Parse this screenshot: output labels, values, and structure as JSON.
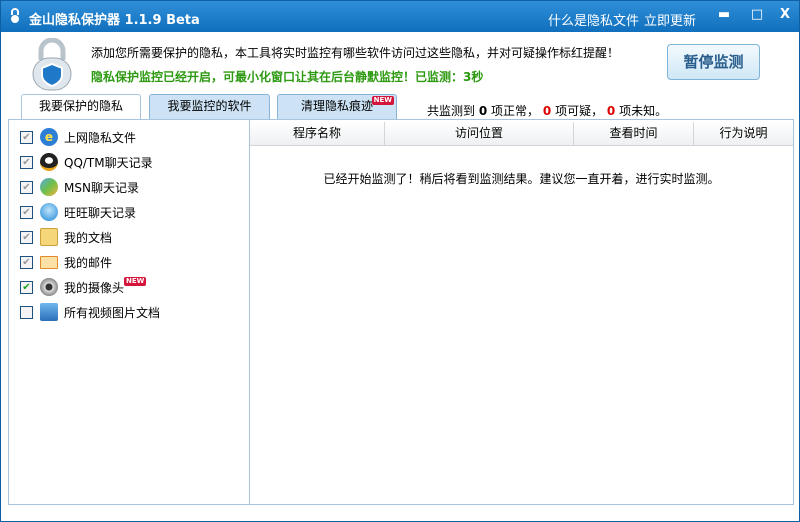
{
  "title": {
    "app": "金山隐私保护器 1.1.9 Beta",
    "links": [
      "什么是隐私文件",
      "立即更新"
    ],
    "min": "▬",
    "max": "□",
    "close": "X"
  },
  "header": {
    "description": "添加您所需要保护的隐私，本工具将实时监控有哪些软件访问过这些隐私，并对可疑操作标红提醒！",
    "status": "隐私保护监控已经开启，可最小化窗口让其在后台静默监控！已监测：3秒",
    "pause_button": "暂停监测"
  },
  "tabs": [
    {
      "label": "我要保护的隐私"
    },
    {
      "label": "我要监控的软件"
    },
    {
      "label": "清理隐私痕迹",
      "badge": "NEW"
    }
  ],
  "counts": {
    "prefix": "共监测到",
    "normal": "0",
    "normal_label": "项正常，",
    "suspicious": "0",
    "suspicious_label": "项可疑，",
    "unknown": "0",
    "unknown_label": "项未知。"
  },
  "items": [
    {
      "label": "上网隐私文件",
      "checked": true,
      "icon": "ie-icon"
    },
    {
      "label": "QQ/TM聊天记录",
      "checked": true,
      "icon": "qq-icon"
    },
    {
      "label": "MSN聊天记录",
      "checked": true,
      "icon": "msn-icon"
    },
    {
      "label": "旺旺聊天记录",
      "checked": true,
      "icon": "wangwang-icon"
    },
    {
      "label": "我的文档",
      "checked": true,
      "icon": "folder-icon"
    },
    {
      "label": "我的邮件",
      "checked": true,
      "icon": "mail-icon"
    },
    {
      "label": "我的摄像头",
      "checked": true,
      "icon": "webcam-icon",
      "badge": "NEW"
    },
    {
      "label": "所有视频图片文档",
      "checked": false,
      "icon": "monitor-icon"
    }
  ],
  "table": {
    "columns": [
      "程序名称",
      "访问位置",
      "查看时间",
      "行为说明"
    ],
    "message": "已经开始监测了！稍后将看到监测结果。建议您一直开着，进行实时监测。"
  }
}
